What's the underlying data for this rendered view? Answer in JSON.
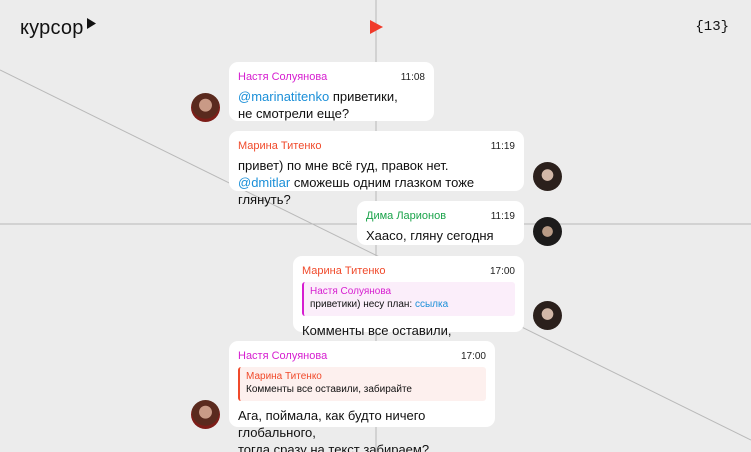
{
  "header": {
    "logo": "курсор",
    "page_number": "{13}"
  },
  "colors": {
    "background": "#ececec",
    "accent": "#f03a2a",
    "mention": "#1a8fd8",
    "name_nastya": "#d61ed0",
    "name_marina": "#f04a2b",
    "name_dima": "#1aa34a"
  },
  "messages": [
    {
      "author": "Настя Солуянова",
      "time": "11:08",
      "mention": "@marinatitenko",
      "line1_rest": " приветики,",
      "line2": "не смотрели еще?"
    },
    {
      "author": "Марина Титенко",
      "time": "11:19",
      "line1": "привет) по мне всё гуд, правок нет.",
      "mention": "@dmitlar",
      "line2_rest": " сможешь одним глазком тоже глянуть?"
    },
    {
      "author": "Дима Ларионов",
      "time": "11:19",
      "text": "Хаасо, гляну сегодня"
    },
    {
      "author": "Марина Титенко",
      "time": "17:00",
      "quote": {
        "author": "Настя Солуянова",
        "text": "приветики) несу план: ",
        "link": "ссылка"
      },
      "text": "Комменты все оставили, забирайте"
    },
    {
      "author": "Настя Солуянова",
      "time": "17:00",
      "quote": {
        "author": "Марина Титенко",
        "text": "Комменты все оставили, забирайте"
      },
      "line1": "Ага, поймала, как будто ничего глобального,",
      "line2": "тогда сразу на текст забираем?"
    }
  ],
  "icons": {
    "logo_cursor": "cursor-arrow-icon",
    "play": "play-icon"
  }
}
